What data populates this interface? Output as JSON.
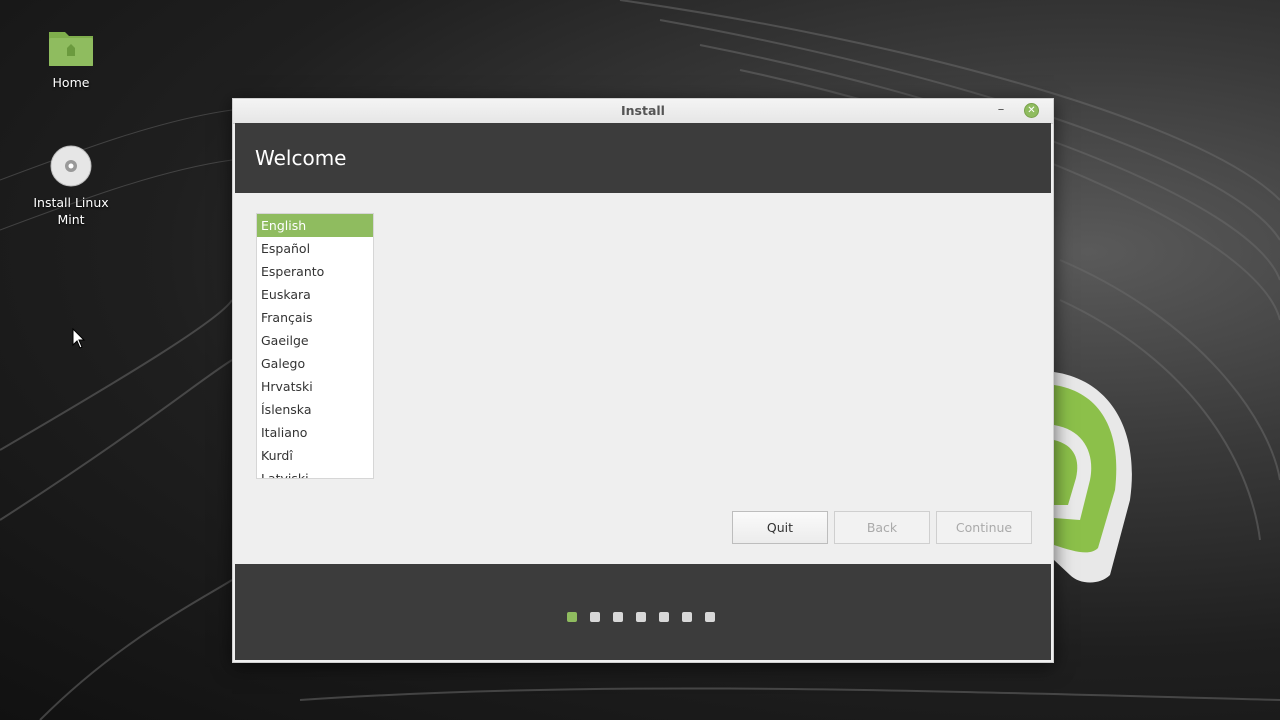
{
  "desktop": {
    "icons": [
      {
        "label": "Home",
        "icon": "folder-home-icon"
      },
      {
        "label": "Install Linux Mint",
        "icon": "disc-icon"
      }
    ]
  },
  "window": {
    "title": "Install",
    "minimize_label": "–",
    "close_label": "✕",
    "page_title": "Welcome"
  },
  "language_list": {
    "selected": "English",
    "items": [
      "English",
      "Español",
      "Esperanto",
      "Euskara",
      "Français",
      "Gaeilge",
      "Galego",
      "Hrvatski",
      "Íslenska",
      "Italiano",
      "Kurdî",
      "Latviski"
    ]
  },
  "buttons": {
    "quit": "Quit",
    "back": "Back",
    "continue": "Continue"
  },
  "progress": {
    "total_steps": 7,
    "current_step": 1
  },
  "colors": {
    "accent": "#8fbc5f",
    "header_bg": "#3c3c3c",
    "content_bg": "#efefef"
  }
}
